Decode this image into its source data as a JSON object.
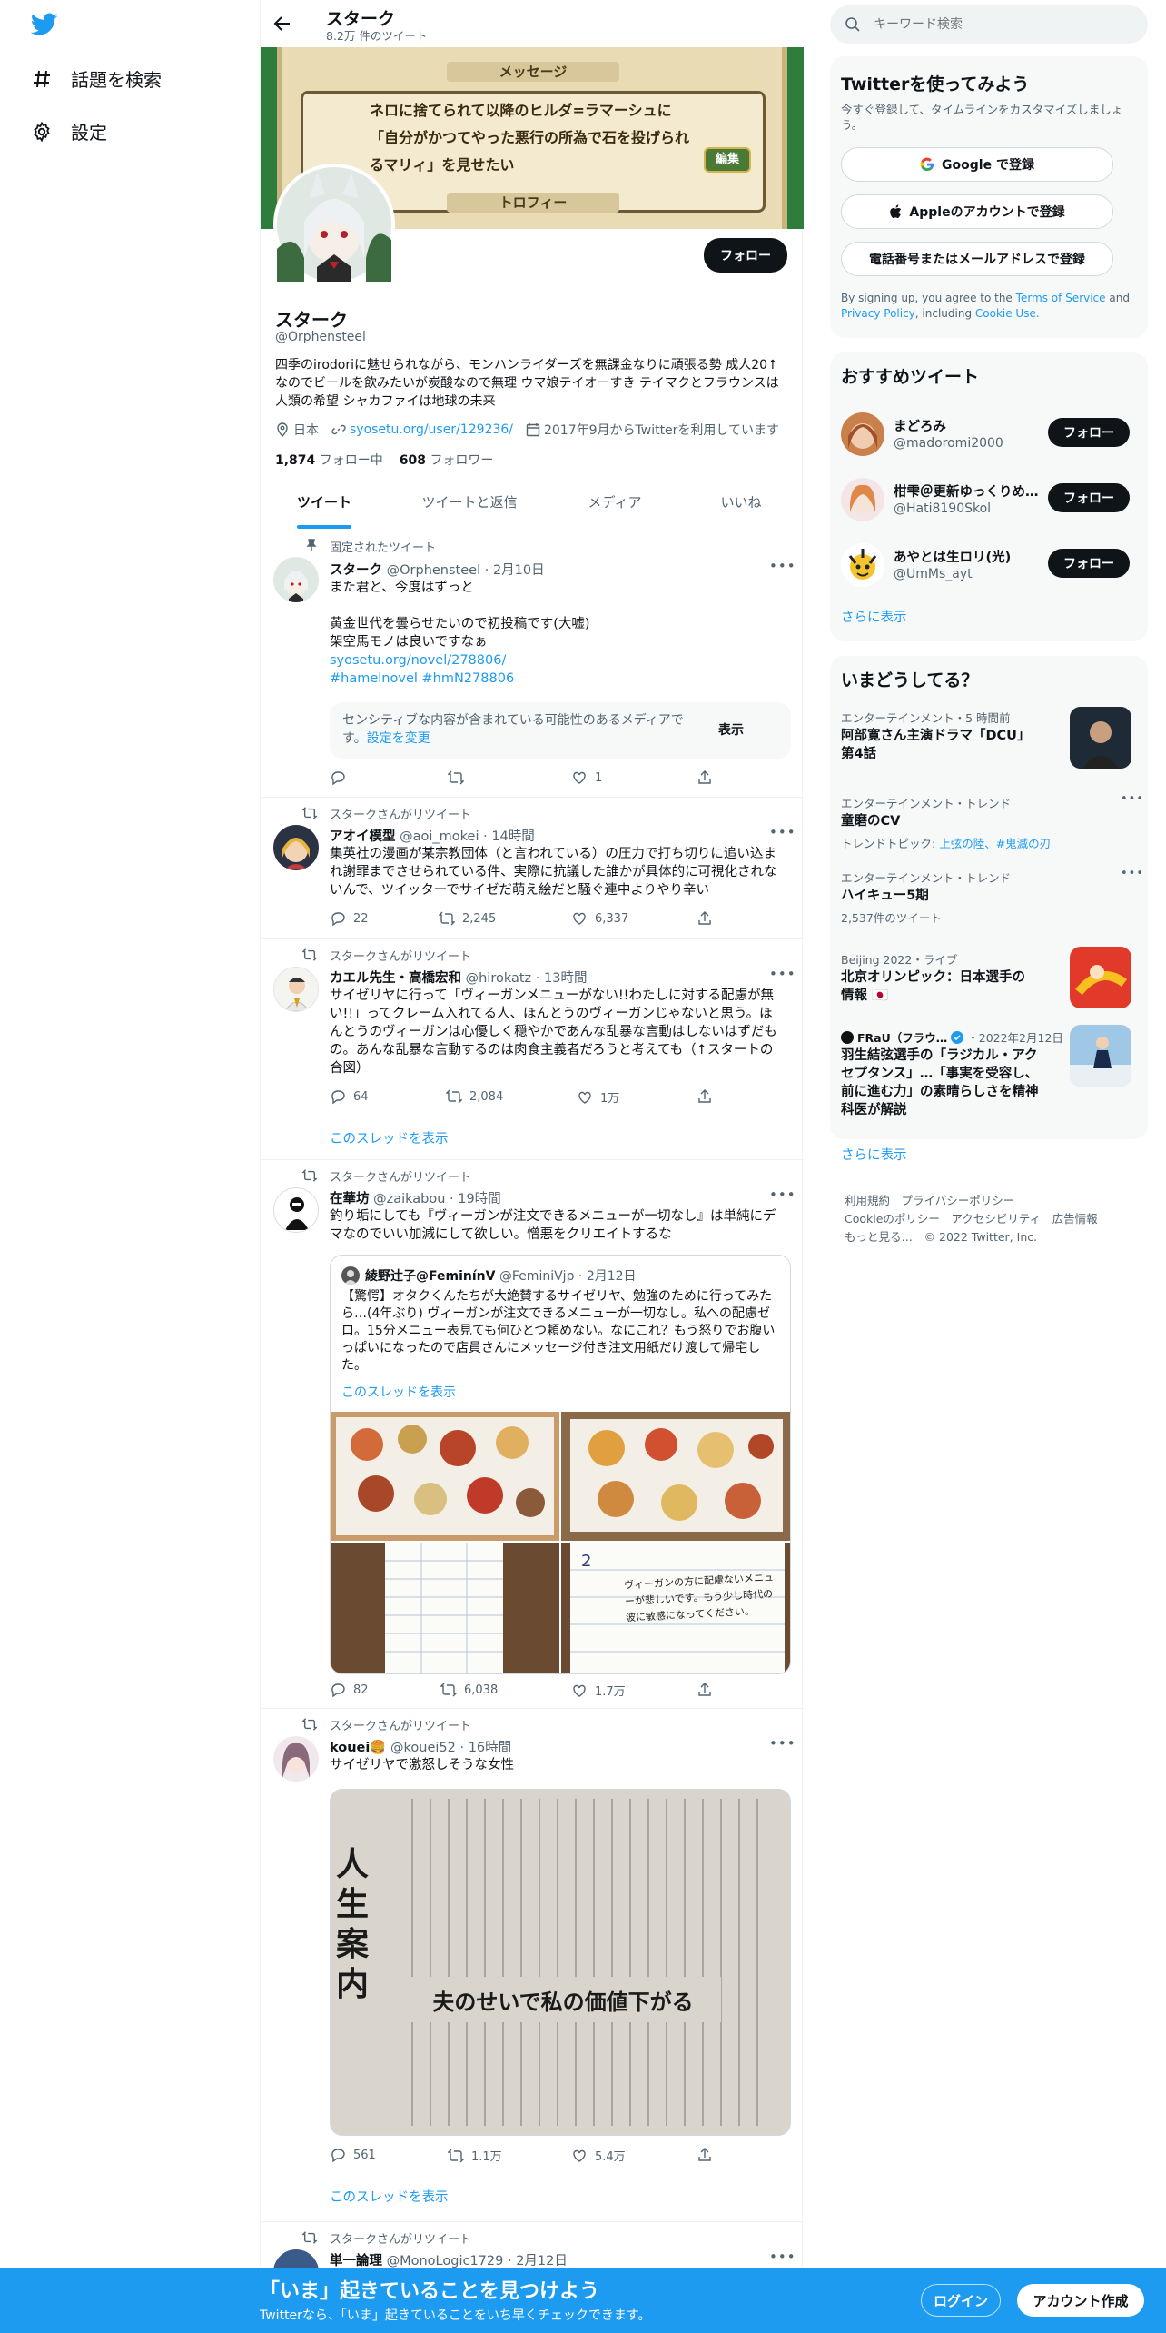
{
  "nav": {
    "items": [
      {
        "label": "話題を検索",
        "icon": "hashtag-icon"
      },
      {
        "label": "設定",
        "icon": "gear-icon"
      }
    ]
  },
  "header": {
    "title": "スターク",
    "subtitle": "8.2万 件のツイート"
  },
  "banner": {
    "heading1": "メッセージ",
    "message": "ネロに捨てられて以降のヒルダ=ラマーシュに「自分がかつてやった悪行の所為で石を投げられるマリィ」を見せたい",
    "edit_label": "編集",
    "heading2": "トロフィー"
  },
  "profile": {
    "follow_label": "フォロー",
    "name": "スターク",
    "handle": "@Orphensteel",
    "bio": "四季のirodoriに魅せられながら、モンハンライダーズを無課金なりに頑張る勢 成人20↑なのでビールを飲みたいが炭酸なので無理 ウマ娘テイオーすき テイマクとフラウンスは人類の希望 シャカファイは地球の未来",
    "location": "日本",
    "url": "syosetu.org/user/129236/",
    "joined": "2017年9月からTwitterを利用しています",
    "following_count": "1,874",
    "following_label": "フォロー中",
    "followers_count": "608",
    "followers_label": "フォロワー"
  },
  "tabs": [
    "ツイート",
    "ツイートと返信",
    "メディア",
    "いいね"
  ],
  "pinned_label": "固定されたツイート",
  "retweet_label": "スタークさんがリツイート",
  "thread_label": "このスレッドを表示",
  "tweets": [
    {
      "name": "スターク",
      "handle": "@Orphensteel",
      "time": "2月10日",
      "lines": [
        "また君と、今度はずっと",
        "",
        "黄金世代を曇らせたいので初投稿です(大嘘)",
        "架空馬モノは良いですなぁ"
      ],
      "link1": "syosetu.org/novel/278806/",
      "link2": "#hamelnovel #hmN278806",
      "sensitive_text": "センシティブな内容が含まれている可能性のあるメディアです。",
      "sensitive_link": "設定を変更",
      "show_label": "表示",
      "reply": "",
      "retweet": "",
      "like": "1"
    },
    {
      "name": "アオイ模型",
      "handle": "@aoi_mokei",
      "time": "14時間",
      "text": "集英社の漫画が某宗教団体（と言われている）の圧力で打ち切りに追い込まれ謝罪までさせられている件、実際に抗議した誰かが具体的に可視化されないんで、ツイッターでサイゼだ萌え絵だと騒ぐ連中よりやり辛い",
      "reply": "22",
      "retweet": "2,245",
      "like": "6,337"
    },
    {
      "name": "カエル先生・高橋宏和",
      "handle": "@hirokatz",
      "time": "13時間",
      "text": "サイゼリヤに行って「ヴィーガンメニューがない!!わたしに対する配慮が無い!!」ってクレーム入れてる人、ほんとうのヴィーガンじゃないと思う。ほんとうのヴィーガンは心優しく穏やかであんな乱暴な言動はしないはずだもの。あんな乱暴な言動するのは肉食主義者だろうと考えても（↑スタートの合図）",
      "reply": "64",
      "retweet": "2,084",
      "like": "1万"
    },
    {
      "name": "在華坊",
      "handle": "@zaikabou",
      "time": "19時間",
      "text": "釣り垢にしても『ヴィーガンが注文できるメニューが一切なし』は単純にデマなのでいい加減にして欲しい。憎悪をクリエイトするな",
      "quote_name": "綾野辻子@FeminínV",
      "quote_handle": "@FeminiVjp",
      "quote_time": "2月12日",
      "quote_text": "【驚愕】オタクくんたちが大絶賛するサイゼリヤ、勉強のために行ってみたら…(4年ぶり) ヴィーガンが注文できるメニューが一切なし。私への配慮ゼロ。15分メニュー表見ても何ひとつ頼めない。なにこれ？もう怒りでお腹いっぱいになったので店員さんにメッセージ付き注文用紙だけ渡して帰宅した。",
      "note_text": "ヴィーガンの方に配慮ないメニューが悲しいです。もう少し時代の波に敏感になってください。",
      "reply": "82",
      "retweet": "6,038",
      "like": "1.7万"
    },
    {
      "name": "kouei🍔",
      "handle": "@kouei52",
      "time": "16時間",
      "text": "サイゼリヤで激怒しそうな女性",
      "news_headline": "夫のせいで私の価値下がる",
      "news_side": "人生案内",
      "reply": "561",
      "retweet": "1.1万",
      "like": "5.4万"
    },
    {
      "name": "単一論理",
      "handle": "@MonoLogic1729",
      "time": "2月12日"
    }
  ],
  "search": {
    "placeholder": "キーワード検索"
  },
  "signup": {
    "title": "Twitterを使ってみよう",
    "subtitle": "今すぐ登録して、タイムラインをカスタマイズしましょう。",
    "google": "Google で登録",
    "apple": "Appleのアカウントで登録",
    "phone": "電話番号またはメールアドレスで登録",
    "legal_prefix": "By signing up, you agree to the",
    "terms": "Terms of Service",
    "and": "and",
    "privacy": "Privacy Policy",
    "including": ", including",
    "cookie": "Cookie Use."
  },
  "recommend": {
    "title": "おすすめツイート",
    "users": [
      {
        "name": "まどろみ",
        "handle": "@madoromi2000"
      },
      {
        "name": "柑雫＠更新ゆっくりめ…",
        "handle": "@Hati8190Skol"
      },
      {
        "name": "あやとは生ロリ(光)",
        "handle": "@UmMs_ayt"
      }
    ],
    "follow_label": "フォロー",
    "more": "さらに表示"
  },
  "trends": {
    "title": "いまどうしてる？",
    "items": [
      {
        "cat": "エンターテインメント・5 時間前",
        "title": "阿部寛さん主演ドラマ「DCU」第4話"
      },
      {
        "cat": "エンターテインメント・トレンド",
        "title": "童磨のCV",
        "sub_prefix": "トレンドトピック: ",
        "sub_link": "上弦の陸、#鬼滅の刃"
      },
      {
        "cat": "エンターテインメント・トレンド",
        "title": "ハイキュー5期",
        "sub": "2,537件のツイート"
      },
      {
        "cat": "Beijing 2022・ライブ",
        "title": "北京オリンピック：日本選手の情報 🇯🇵"
      },
      {
        "cat_name": "FRaU（フラウ…",
        "cat_date": "・2022年2月12日",
        "title": "羽生結弦選手の「ラジカル・アクセプタンス」…「事実を受容し、前に進む力」の素晴らしさを精神科医が解説"
      }
    ],
    "more": "さらに表示"
  },
  "footer": {
    "line1": [
      "利用規約",
      "プライバシーポリシー"
    ],
    "line2": [
      "Cookieのポリシー",
      "アクセシビリティ",
      "広告情報"
    ],
    "more": "もっと見る…",
    "copyright": "© 2022 Twitter, Inc."
  },
  "bottombar": {
    "title": "「いま」起きていることを見つけよう",
    "subtitle": "Twitterなら、「いま」起きていることをいち早くチェックできます。",
    "login": "ログイン",
    "signup": "アカウント作成"
  },
  "colors": {
    "accent": "#1d9bf0",
    "text": "#0f1419",
    "muted": "#536471"
  }
}
